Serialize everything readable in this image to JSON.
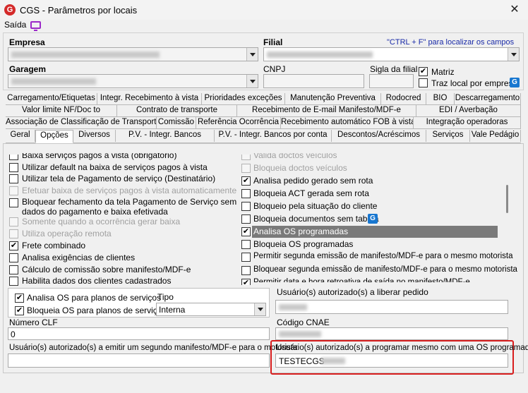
{
  "window": {
    "title": "CGS - Parâmetros por locais",
    "close": "✕"
  },
  "menu": {
    "saida": "Saída"
  },
  "header": {
    "empresa_label": "Empresa",
    "filial_label": "Filial",
    "filial_hint": "\"CTRL + F\" para localizar os campos",
    "garagem_label": "Garagem",
    "cnpj_label": "CNPJ",
    "sigla_label": "Sigla da filial",
    "matriz_label": "Matriz",
    "matriz_checked": "✔",
    "traz_local_label": "Traz local por empresa",
    "g_icon": "G"
  },
  "tabs": {
    "row1": [
      "Carregamento/Etiquetas",
      "Integr. Recebimento à vista",
      "Prioridades exceções",
      "Manutenção Preventiva",
      "Rodocred",
      "BIO",
      "Descarregamento"
    ],
    "row2": [
      "Valor limite NF/Doc to",
      "Contrato de transporte",
      "Recebimento de E-mail Manifesto/MDF-e",
      "EDI / Averbação"
    ],
    "row3": [
      "Associação de Classificação de Transporte",
      "Comissão",
      "Referência Ocorrência",
      "Recebimento automático FOB à vista",
      "Integração operadoras"
    ],
    "row4": [
      "Geral",
      "Opções",
      "Diversos",
      "P.V. - Integr. Bancos",
      "P.V. - Integr. Bancos por conta",
      "Descontos/Acréscimos",
      "Serviços",
      "Vale Pedágio"
    ],
    "active": "Opções"
  },
  "left_options": [
    {
      "label": "Baixa serviços pagos à vista (obrigatório)",
      "checked": "",
      "disabled": false
    },
    {
      "label": "Utilizar default na baixa de serviços pagos à vista",
      "checked": "",
      "disabled": false
    },
    {
      "label": "Utilizar tela de Pagamento de serviço (Destinatário)",
      "checked": "",
      "disabled": false
    },
    {
      "label": "Efetuar baixa de serviços pagos à vista automaticamente",
      "checked": "",
      "disabled": true
    },
    {
      "label": "Bloquear fechamento da tela Pagamento de Serviço sem",
      "label2": "dados do pagamento e baixa efetivada",
      "checked": "",
      "disabled": false
    },
    {
      "label": "Somente quando a ocorrência gerar baixa",
      "checked": "",
      "disabled": true
    },
    {
      "label": "Utiliza operação remota",
      "checked": "",
      "disabled": true
    },
    {
      "label": "Frete combinado",
      "checked": "✔",
      "disabled": false
    },
    {
      "label": "Analisa exigências de clientes",
      "checked": "",
      "disabled": false
    },
    {
      "label": "Cálculo de comissão sobre manifesto/MDF-e",
      "checked": "",
      "disabled": false
    },
    {
      "label": "Habilita dados dos clientes cadastrados",
      "checked": "",
      "disabled": false
    }
  ],
  "right_options": [
    {
      "label": "Valida doctos veículos",
      "checked": "",
      "disabled": true
    },
    {
      "label": "Bloqueia doctos veículos",
      "checked": "",
      "disabled": true
    },
    {
      "label": "Analisa pedido gerado sem rota",
      "checked": "✔",
      "disabled": false
    },
    {
      "label": "Bloqueia ACT gerada sem rota",
      "checked": "",
      "disabled": false
    },
    {
      "label": "Bloqueio pela situação do cliente",
      "checked": "",
      "disabled": false
    },
    {
      "label": "Bloqueia documentos sem tabela",
      "checked": "",
      "disabled": false
    },
    {
      "label": "Analisa OS programadas",
      "checked": "✔",
      "disabled": false,
      "selected": true
    },
    {
      "label": "Bloqueia OS programadas",
      "checked": "",
      "disabled": false
    },
    {
      "label": "Permitir segunda emissão de manifesto/MDF-e para o mesmo motorista",
      "checked": "",
      "disabled": false
    },
    {
      "label": "Bloquear segunda emissão de manifesto/MDF-e para o mesmo motorista",
      "checked": "",
      "disabled": false
    },
    {
      "label": "Permitir data e hora retroativa de saída no manifesto/MDF-e",
      "checked": "✔",
      "disabled": false
    }
  ],
  "os_box": {
    "analisa_label": "Analisa OS para planos de serviços",
    "analisa_checked": "✔",
    "bloqueia_label": "Bloqueia OS para planos de serviços",
    "bloqueia_checked": "✔",
    "tipo_label": "Tipo",
    "tipo_value": "Interna"
  },
  "bottom": {
    "numero_clf_label": "Número CLF",
    "numero_clf_value": "0",
    "usuarios_liberar_label": "Usuário(s) autorizado(s) a liberar pedido",
    "codigo_cnae_label": "Código CNAE",
    "usuarios_segundo_label": "Usuário(s) autorizado(s) a emitir um segundo manifesto/MDF-e para o motorista",
    "usuarios_programar_label": "Usuário(s) autorizado(s) a programar mesmo com uma OS programada",
    "usuarios_programar_value": "TESTECGS"
  },
  "colors": {
    "selection": "#7a7a7a",
    "highlight": "#d81e1e",
    "accent": "#1877d0"
  }
}
